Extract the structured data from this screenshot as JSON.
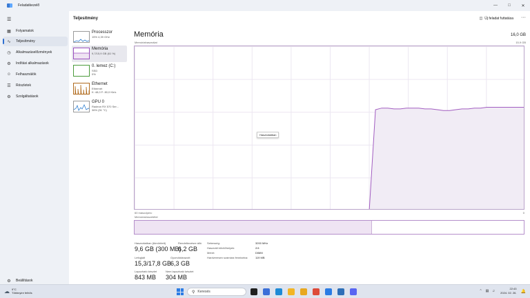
{
  "window": {
    "title": "Feladatkezelő",
    "controls": [
      "minimize-icon",
      "maximize-icon",
      "close-icon"
    ]
  },
  "sidebar": {
    "items": [
      {
        "label": "Folyamatok",
        "icon": "processes-icon"
      },
      {
        "label": "Teljesítmény",
        "icon": "performance-icon",
        "active": true
      },
      {
        "label": "Alkalmazáselőzmények",
        "icon": "history-icon"
      },
      {
        "label": "Indítási alkalmazások",
        "icon": "startup-icon"
      },
      {
        "label": "Felhasználók",
        "icon": "users-icon"
      },
      {
        "label": "Részletek",
        "icon": "details-icon"
      },
      {
        "label": "Szolgáltatások",
        "icon": "services-icon"
      }
    ],
    "settings_label": "Beállítások"
  },
  "header": {
    "title": "Teljesítmény",
    "run_task_label": "Új feladat futtatása",
    "more_label": "···"
  },
  "devices": [
    {
      "name": "Processzor",
      "sub1": "15% 4,39 GHz",
      "sub2": "",
      "sub3": "",
      "color": "#2f7fd0"
    },
    {
      "name": "Memória",
      "sub1": "9,7/15,9 GB (61 %)",
      "sub2": "",
      "sub3": "",
      "color": "#9b4fbf",
      "active": true
    },
    {
      "name": "0. lemez (C:)",
      "sub1": "SSD",
      "sub2": "0%",
      "sub3": "",
      "color": "#4a9a3a"
    },
    {
      "name": "Ethernet",
      "sub1": "Ethernet",
      "sub2": "K: 48,0  F: 80,0 Kb/s",
      "sub3": "",
      "color": "#b06a1c"
    },
    {
      "name": "GPU 0",
      "sub1": "Radeon RX 570 Ser...",
      "sub2": "36% (51 °C)",
      "sub3": "",
      "color": "#2f7fd0"
    }
  ],
  "memory": {
    "title": "Memória",
    "total": "16,0 GB",
    "usage_label": "Memóriahasználat",
    "usage_max": "15,9 GB",
    "graph_span_label": "60 másodperc",
    "graph_zero_label": "0",
    "composition_label": "Memóriaösszetétel",
    "tooltip": "Használatban",
    "usage_fraction": 0.61,
    "in_use_fraction": 0.61,
    "history": [
      0,
      0,
      0,
      0,
      0,
      0,
      0,
      0,
      0,
      0,
      0,
      0,
      0,
      0,
      0,
      0,
      0,
      0,
      0,
      0,
      0,
      0,
      0,
      0,
      0,
      0,
      0,
      0,
      0,
      0,
      0,
      0,
      0,
      0,
      0,
      0,
      0,
      0,
      0,
      0.61,
      0.62,
      0.62,
      0.615,
      0.615,
      0.62,
      0.62,
      0.62,
      0.615,
      0.615,
      0.61,
      0.605,
      0.605,
      0.61,
      0.615,
      0.615,
      0.62,
      0.62,
      0.625,
      0.625,
      0.625,
      0.625,
      0.625,
      0.625,
      0.625
    ]
  },
  "stats": {
    "in_use_label": "Használatban (tömörített)",
    "in_use_value": "9,6 GB (300 MB)",
    "available_label": "Rendelkezésre álló",
    "available_value": "6,2 GB",
    "committed_label": "Lefoglalt",
    "committed_value": "15,3/17,8 GB",
    "cached_label": "Gyorsítótárazott",
    "cached_value": "6,3 GB",
    "paged_label": "Lapozható készlet",
    "paged_value": "843 MB",
    "nonpaged_label": "Nem lapozható készlet",
    "nonpaged_value": "304 MB"
  },
  "info": [
    {
      "key": "Sebesség:",
      "value": "3200 MHz"
    },
    {
      "key": "Használt bővítőhelyek:",
      "value": "2/4"
    },
    {
      "key": "Méret:",
      "value": "DIMM"
    },
    {
      "key": "Hardveresen számára fenntartva:",
      "value": "119 MB"
    }
  ],
  "taskbar": {
    "weather_temp": "9°C",
    "weather_desc": "Többnyire felhős",
    "search_placeholder": "Keresés",
    "time": "22:43",
    "date": "2024. 02. 26.",
    "apps": [
      {
        "icon": "widgets-icon",
        "color": "#1f1f1f"
      },
      {
        "icon": "store-icon",
        "color": "#3b6fd8"
      },
      {
        "icon": "edge-icon",
        "color": "#1d8ad6"
      },
      {
        "icon": "file-explorer-icon",
        "color": "#f2b526"
      },
      {
        "icon": "files-icon",
        "color": "#e8a820"
      },
      {
        "icon": "chrome-icon",
        "color": "#dd4b39"
      },
      {
        "icon": "task-manager-icon",
        "color": "#2a7be4"
      },
      {
        "icon": "terminal-icon",
        "color": "#2e6fb8"
      },
      {
        "icon": "discord-icon",
        "color": "#5865f2"
      }
    ]
  }
}
